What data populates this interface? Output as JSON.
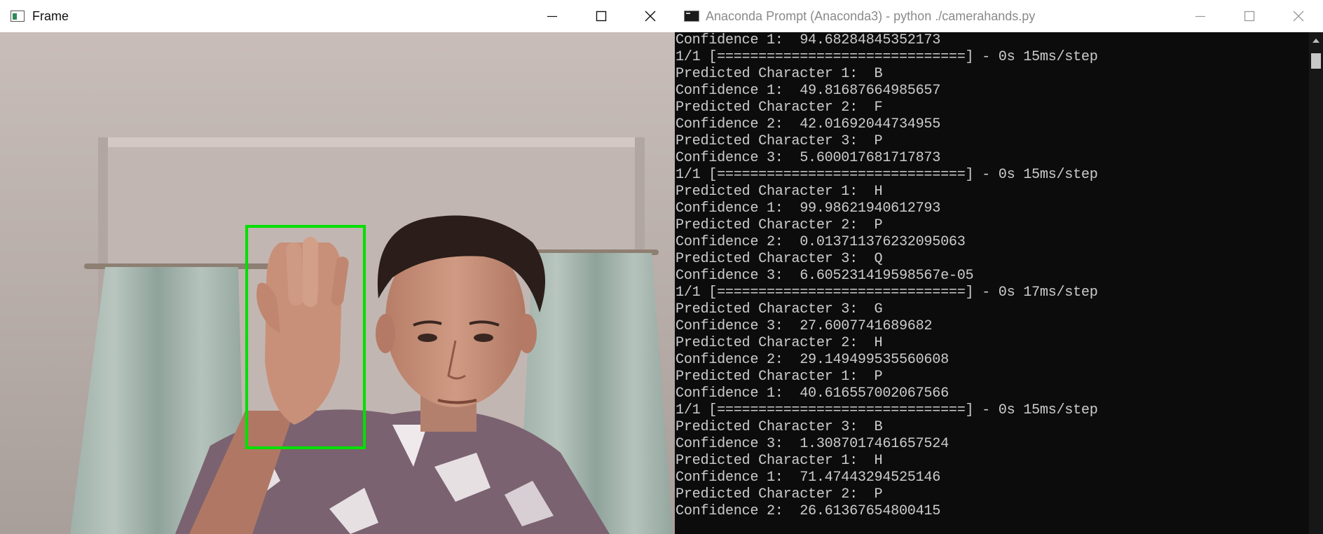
{
  "frame_window": {
    "title": "Frame",
    "controls": {
      "minimize": "minimize-icon",
      "maximize": "maximize-icon",
      "close": "close-icon"
    }
  },
  "terminal_window": {
    "title": "Anaconda Prompt (Anaconda3) - python  ./camerahands.py",
    "lines": [
      "Confidence 1:  94.68284845352173",
      "1/1 [==============================] - 0s 15ms/step",
      "Predicted Character 1:  B",
      "Confidence 1:  49.81687664985657",
      "Predicted Character 2:  F",
      "Confidence 2:  42.01692044734955",
      "Predicted Character 3:  P",
      "Confidence 3:  5.600017681717873",
      "1/1 [==============================] - 0s 15ms/step",
      "Predicted Character 1:  H",
      "Confidence 1:  99.98621940612793",
      "Predicted Character 2:  P",
      "Confidence 2:  0.013711376232095063",
      "Predicted Character 3:  Q",
      "Confidence 3:  6.605231419598567e-05",
      "1/1 [==============================] - 0s 17ms/step",
      "Predicted Character 3:  G",
      "Confidence 3:  27.6007741689682",
      "Predicted Character 2:  H",
      "Confidence 2:  29.149499535560608",
      "Predicted Character 1:  P",
      "Confidence 1:  40.616557002067566",
      "1/1 [==============================] - 0s 15ms/step",
      "Predicted Character 3:  B",
      "Confidence 3:  1.3087017461657524",
      "Predicted Character 1:  H",
      "Confidence 1:  71.47443294525146",
      "Predicted Character 2:  P",
      "Confidence 2:  26.61367654800415"
    ]
  },
  "colors": {
    "detection_box": "#00e000",
    "terminal_bg": "#0c0c0c",
    "terminal_text": "#cccccc"
  }
}
